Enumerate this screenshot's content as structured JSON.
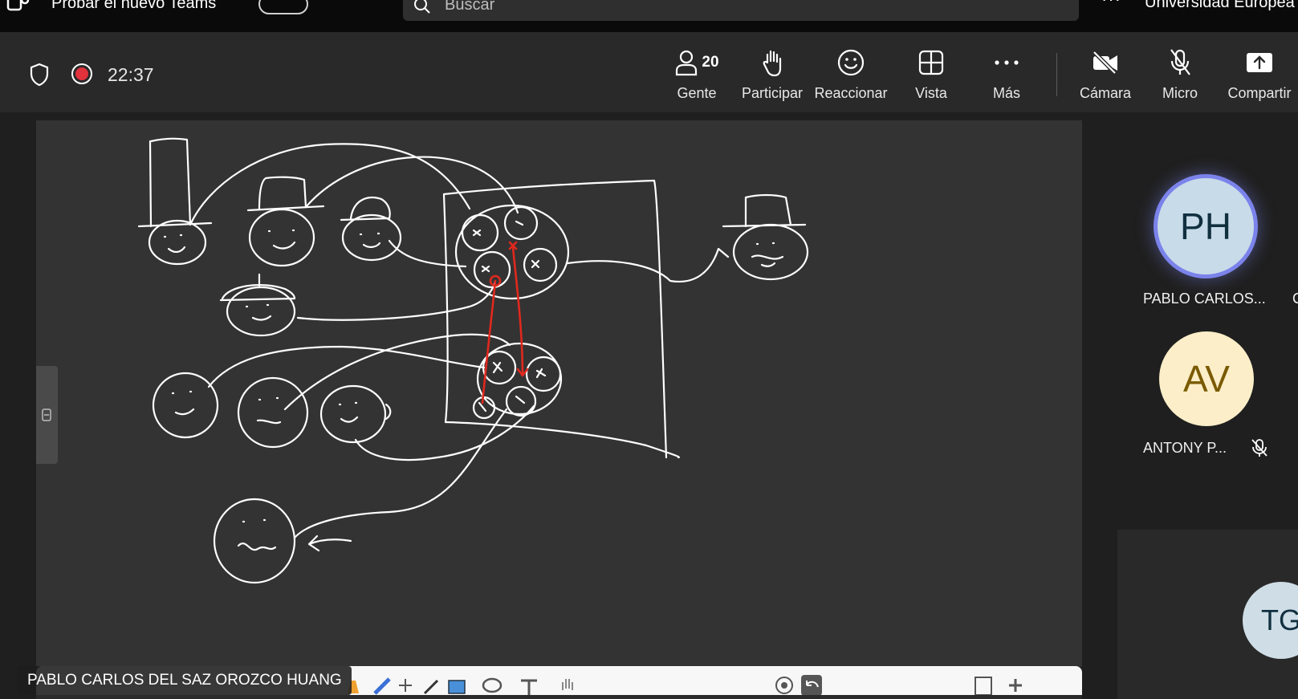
{
  "topbar": {
    "new_teams_label": "Probar el nuevo Teams",
    "search_placeholder": "Buscar",
    "more_label": "···",
    "org_name": "Universidad Europea"
  },
  "meeting": {
    "timer": "22:37",
    "recording": true,
    "people_count": "20",
    "buttons": {
      "people": "Gente",
      "raise_hand": "Participar",
      "react": "Reaccionar",
      "view": "Vista",
      "more": "Más",
      "camera": "Cámara",
      "mic": "Micro",
      "share": "Compartir"
    }
  },
  "stage": {
    "presenter_name": "PABLO CARLOS DEL SAZ OROZCO HUANG",
    "whiteboard_background": "#333333",
    "ink_color": "#ffffff",
    "highlight_ink_color": "#e0281e"
  },
  "participants": [
    {
      "initials": "PH",
      "name": "PABLO CARLOS...",
      "speaking": true,
      "avatar_bg": "#c8dbe9"
    },
    {
      "initials": "AV",
      "name": "ANTONY P...",
      "muted": true,
      "avatar_bg": "#fbeec8"
    },
    {
      "initials": "TG",
      "avatar_bg": "#cfdde6"
    }
  ],
  "participant_partial_next": "C",
  "colors": {
    "accent_ring": "#7b83eb",
    "recording_red": "#e0313c",
    "toolbar_bg": "#292929"
  }
}
